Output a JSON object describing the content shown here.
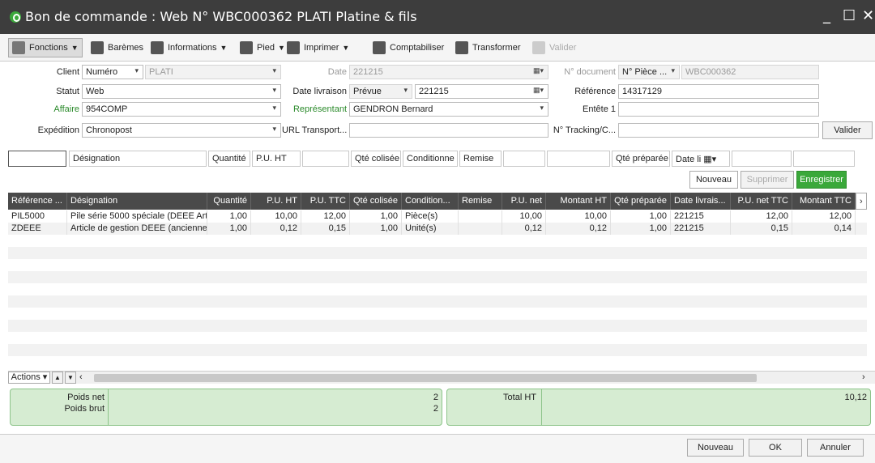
{
  "window": {
    "title": "Bon de commande : Web N° WBC000362 PLATI Platine & fils",
    "minimize": "_",
    "maximize": "☐",
    "close": "✕"
  },
  "toolbar": {
    "fonctions": "Fonctions",
    "baremes": "Barèmes",
    "informations": "Informations",
    "pied": "Pied",
    "imprimer": "Imprimer",
    "comptabiliser": "Comptabiliser",
    "transformer": "Transformer",
    "valider": "Valider"
  },
  "form": {
    "client_label": "Client",
    "client_type": "Numéro",
    "client_code": "PLATI",
    "statut_label": "Statut",
    "statut_value": "Web",
    "affaire_label": "Affaire",
    "affaire_value": "954COMP",
    "expedition_label": "Expédition",
    "expedition_value": "Chronopost",
    "date_label": "Date",
    "date_value": "221215",
    "date_livraison_label": "Date livraison",
    "date_livraison_type": "Prévue",
    "date_livraison_value": "221215",
    "representant_label": "Représentant",
    "representant_value": "GENDRON Bernard",
    "url_label": "URL Transport...",
    "url_value": "",
    "ndoc_label": "N° document",
    "ndoc_type": "N° Pièce ...",
    "ndoc_value": "WBC000362",
    "reference_label": "Référence",
    "reference_value": "14317129",
    "entete_label": "Entête 1",
    "entete_value": "",
    "tracking_label": "N° Tracking/C...",
    "tracking_value": "",
    "valider": "Valider"
  },
  "filter": {
    "designation": "Désignation",
    "quantite": "Quantité",
    "pu_ht": "P.U. HT",
    "qte_colisee": "Qté colisée",
    "conditionne": "Conditionne",
    "remise": "Remise",
    "qte_preparee": "Qté préparée",
    "date_li": "Date li"
  },
  "line_actions": {
    "nouveau": "Nouveau",
    "supprimer": "Supprimer",
    "enregistrer": "Enregistrer"
  },
  "grid": {
    "columns": [
      "Référence ...",
      "Désignation",
      "Quantité",
      "P.U. HT",
      "P.U. TTC",
      "Qté colisée",
      "Condition...",
      "Remise",
      "P.U. net",
      "Montant HT",
      "Qté préparée",
      "Date livrais...",
      "P.U. net TTC",
      "Montant TTC"
    ],
    "rows": [
      [
        "PIL5000",
        "Pile série 5000 spéciale (DEEE Art. ...",
        "1,00",
        "10,00",
        "12,00",
        "1,00",
        "Pièce(s)",
        "",
        "10,00",
        "10,00",
        "1,00",
        "221215",
        "12,00",
        "12,00"
      ],
      [
        "ZDEEE",
        "Article de gestion DEEE (ancienne...",
        "1,00",
        "0,12",
        "0,15",
        "1,00",
        "Unité(s)",
        "",
        "0,12",
        "0,12",
        "1,00",
        "221215",
        "0,15",
        "0,14"
      ]
    ]
  },
  "grid_footer": {
    "actions": "Actions"
  },
  "totals": {
    "poids_net_label": "Poids net",
    "poids_net_value": "2",
    "poids_brut_label": "Poids brut",
    "poids_brut_value": "2",
    "total_ht_label": "Total HT",
    "total_ht_value": "10,12"
  },
  "bottom": {
    "nouveau": "Nouveau",
    "ok": "OK",
    "annuler": "Annuler"
  }
}
